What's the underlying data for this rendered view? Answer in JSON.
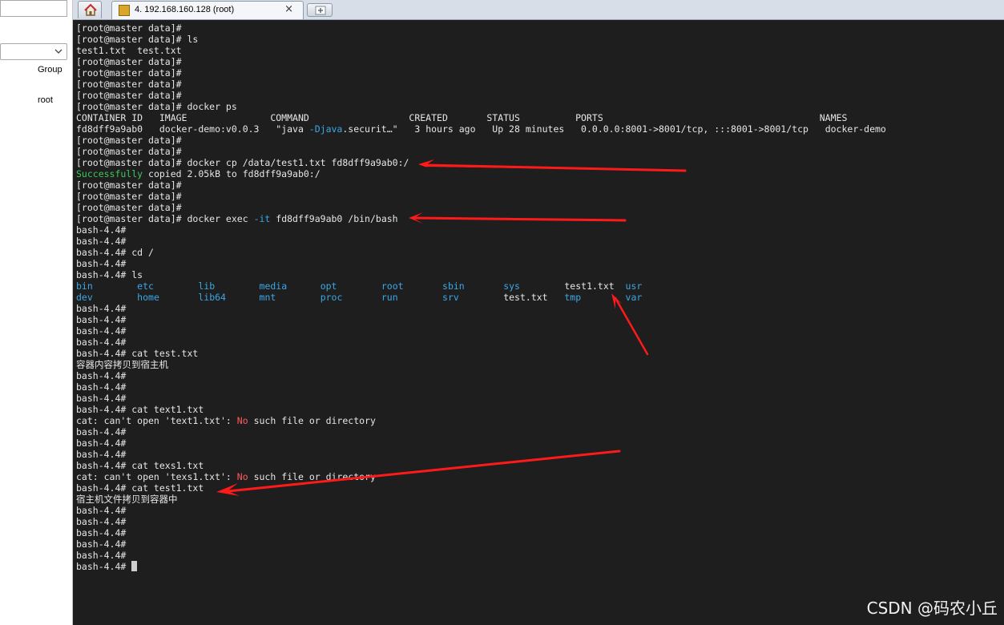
{
  "sidebar": {
    "search_value": "",
    "select_value": "",
    "group_label": "Group",
    "root_label": "root"
  },
  "tabs": {
    "home_icon": "home-icon",
    "session_label": "4. 192.168.160.128 (root)",
    "close_glyph": "×",
    "new_tab_icon": "plus-icon"
  },
  "colors": {
    "terminal_bg": "#1e1e1e",
    "text": "#e6e6e6",
    "dir_blue": "#3aa8e6",
    "success_green": "#3cc95a",
    "error_red": "#ff5a5a",
    "arrow_red": "#ff1a1a"
  },
  "terminal": {
    "lines": [
      [
        {
          "t": "[root@master data]#"
        }
      ],
      [
        {
          "t": "[root@master data]# ls"
        }
      ],
      [
        {
          "t": "test1.txt  test.txt"
        }
      ],
      [
        {
          "t": "[root@master data]#"
        }
      ],
      [
        {
          "t": "[root@master data]#"
        }
      ],
      [
        {
          "t": "[root@master data]#"
        }
      ],
      [
        {
          "t": "[root@master data]#"
        }
      ],
      [
        {
          "t": "[root@master data]# docker ps"
        }
      ],
      [
        {
          "t": "CONTAINER ID   IMAGE               COMMAND                  CREATED       STATUS          PORTS                                       NAMES"
        }
      ],
      [
        {
          "t": "fd8dff9a9ab0   docker-demo:v0.0.3   \"java "
        },
        {
          "t": "-Djava",
          "c": "blue"
        },
        {
          "t": ".securit…\"   3 hours ago   Up 28 minutes   0.0.0.0:8001->8001/tcp, :::8001->8001/tcp   docker-demo"
        }
      ],
      [
        {
          "t": "[root@master data]#"
        }
      ],
      [
        {
          "t": "[root@master data]#"
        }
      ],
      [
        {
          "t": "[root@master data]# docker cp /data/test1.txt fd8dff9a9ab0:/"
        }
      ],
      [
        {
          "t": "Successfully",
          "c": "green"
        },
        {
          "t": " copied 2.05kB to fd8dff9a9ab0:/"
        }
      ],
      [
        {
          "t": "[root@master data]#"
        }
      ],
      [
        {
          "t": "[root@master data]#"
        }
      ],
      [
        {
          "t": "[root@master data]#"
        }
      ],
      [
        {
          "t": "[root@master data]# docker exec "
        },
        {
          "t": "-it",
          "c": "blue"
        },
        {
          "t": " fd8dff9a9ab0 /bin/bash"
        }
      ],
      [
        {
          "t": "bash-4.4#"
        }
      ],
      [
        {
          "t": "bash-4.4#"
        }
      ],
      [
        {
          "t": "bash-4.4# cd /"
        }
      ],
      [
        {
          "t": "bash-4.4#"
        }
      ],
      [
        {
          "t": "bash-4.4# ls"
        }
      ],
      [
        {
          "t": "bin",
          "c": "blue"
        },
        {
          "t": "        "
        },
        {
          "t": "etc",
          "c": "blue"
        },
        {
          "t": "        "
        },
        {
          "t": "lib",
          "c": "blue"
        },
        {
          "t": "        "
        },
        {
          "t": "media",
          "c": "blue"
        },
        {
          "t": "      "
        },
        {
          "t": "opt",
          "c": "blue"
        },
        {
          "t": "        "
        },
        {
          "t": "root",
          "c": "blue"
        },
        {
          "t": "       "
        },
        {
          "t": "sbin",
          "c": "blue"
        },
        {
          "t": "       "
        },
        {
          "t": "sys",
          "c": "blue"
        },
        {
          "t": "        test1.txt  "
        },
        {
          "t": "usr",
          "c": "blue"
        }
      ],
      [
        {
          "t": "dev",
          "c": "blue"
        },
        {
          "t": "        "
        },
        {
          "t": "home",
          "c": "blue"
        },
        {
          "t": "       "
        },
        {
          "t": "lib64",
          "c": "blue"
        },
        {
          "t": "      "
        },
        {
          "t": "mnt",
          "c": "blue"
        },
        {
          "t": "        "
        },
        {
          "t": "proc",
          "c": "blue"
        },
        {
          "t": "       "
        },
        {
          "t": "run",
          "c": "blue"
        },
        {
          "t": "        "
        },
        {
          "t": "srv",
          "c": "blue"
        },
        {
          "t": "        test.txt   "
        },
        {
          "t": "tmp",
          "c": "blue"
        },
        {
          "t": "        "
        },
        {
          "t": "var",
          "c": "blue"
        }
      ],
      [
        {
          "t": "bash-4.4#"
        }
      ],
      [
        {
          "t": "bash-4.4#"
        }
      ],
      [
        {
          "t": "bash-4.4#"
        }
      ],
      [
        {
          "t": "bash-4.4#"
        }
      ],
      [
        {
          "t": "bash-4.4# cat test.txt"
        }
      ],
      [
        {
          "t": "容器内容拷贝到宿主机"
        }
      ],
      [
        {
          "t": "bash-4.4#"
        }
      ],
      [
        {
          "t": "bash-4.4#"
        }
      ],
      [
        {
          "t": "bash-4.4#"
        }
      ],
      [
        {
          "t": "bash-4.4# cat text1.txt"
        }
      ],
      [
        {
          "t": "cat: can't open 'text1.txt': "
        },
        {
          "t": "No",
          "c": "red"
        },
        {
          "t": " such file or directory"
        }
      ],
      [
        {
          "t": "bash-4.4#"
        }
      ],
      [
        {
          "t": "bash-4.4#"
        }
      ],
      [
        {
          "t": "bash-4.4#"
        }
      ],
      [
        {
          "t": "bash-4.4# cat texs1.txt"
        }
      ],
      [
        {
          "t": "cat: can't open 'texs1.txt': "
        },
        {
          "t": "No",
          "c": "red"
        },
        {
          "t": " such file or directory"
        }
      ],
      [
        {
          "t": "bash-4.4# cat test1.txt"
        }
      ],
      [
        {
          "t": "宿主机文件拷贝到容器中"
        }
      ],
      [
        {
          "t": "bash-4.4#"
        }
      ],
      [
        {
          "t": "bash-4.4#"
        }
      ],
      [
        {
          "t": "bash-4.4#"
        }
      ],
      [
        {
          "t": "bash-4.4#"
        }
      ],
      [
        {
          "t": "bash-4.4#"
        }
      ],
      [
        {
          "t": "bash-4.4# "
        },
        {
          "cursor": true
        }
      ]
    ]
  },
  "watermark": "CSDN @码农小丘"
}
